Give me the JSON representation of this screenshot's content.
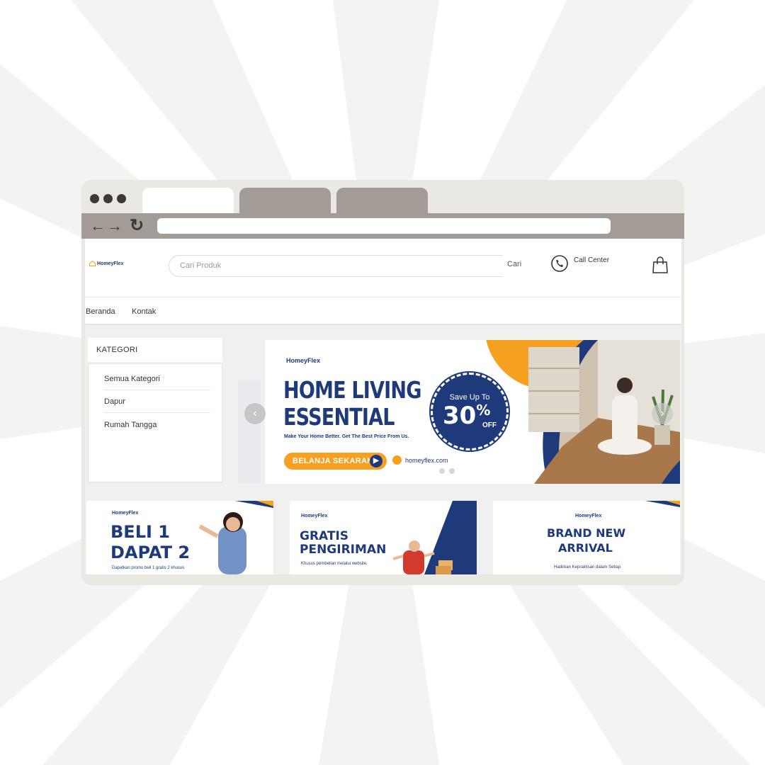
{
  "colors": {
    "brand_navy": "#1e3a7a",
    "brand_orange": "#f5a020",
    "browser_chrome": "#e9e8e3",
    "browser_toolbar": "#a39b95",
    "window_dots": "#3d3834"
  },
  "browser": {
    "tabs": [
      "",
      "",
      ""
    ],
    "back_icon": "arrow-left-icon",
    "forward_icon": "arrow-right-icon",
    "reload_icon": "reload-icon",
    "address": ""
  },
  "header": {
    "logo_text": "HomeyFlex",
    "search_placeholder": "Cari Produk",
    "search_button": "Cari",
    "call_center_label": "Call Center",
    "call_icon": "phone-icon",
    "cart_icon": "shopping-bag-icon"
  },
  "nav": {
    "items": [
      "Beranda",
      "Kontak"
    ]
  },
  "sidebar": {
    "title": "KATEGORI",
    "items": [
      "Semua Kategori",
      "Dapur",
      "Rumah Tangga"
    ]
  },
  "hero_banner": {
    "logo": "HomeyFlex",
    "title_line1": "HOME LIVING",
    "title_line2": "ESSENTIAL",
    "subtitle": "Make Your Home Better. Get The Best Price From Us.",
    "cta": "BELANJA SEKARANG",
    "website": "homeyflex.com",
    "badge_top": "Save Up To",
    "badge_value": "30",
    "badge_percent": "%",
    "badge_off": "OFF",
    "slide_count": 2,
    "active_slide": 1
  },
  "promos": [
    {
      "logo": "HomeyFlex",
      "line1": "BELI 1",
      "line2": "DAPAT 2",
      "small": "Dapatkan promo beli 1 gratis 2 khusus"
    },
    {
      "logo": "HomeyFlex",
      "line1": "GRATIS",
      "line2": "PENGIRIMAN",
      "small": "Khusus pembelian melalui website."
    },
    {
      "logo": "HomeyFlex",
      "line1": "BRAND NEW",
      "line2": "ARRIVAL",
      "small": "Hadirkan Kepraktisan dalam Setiap"
    }
  ]
}
